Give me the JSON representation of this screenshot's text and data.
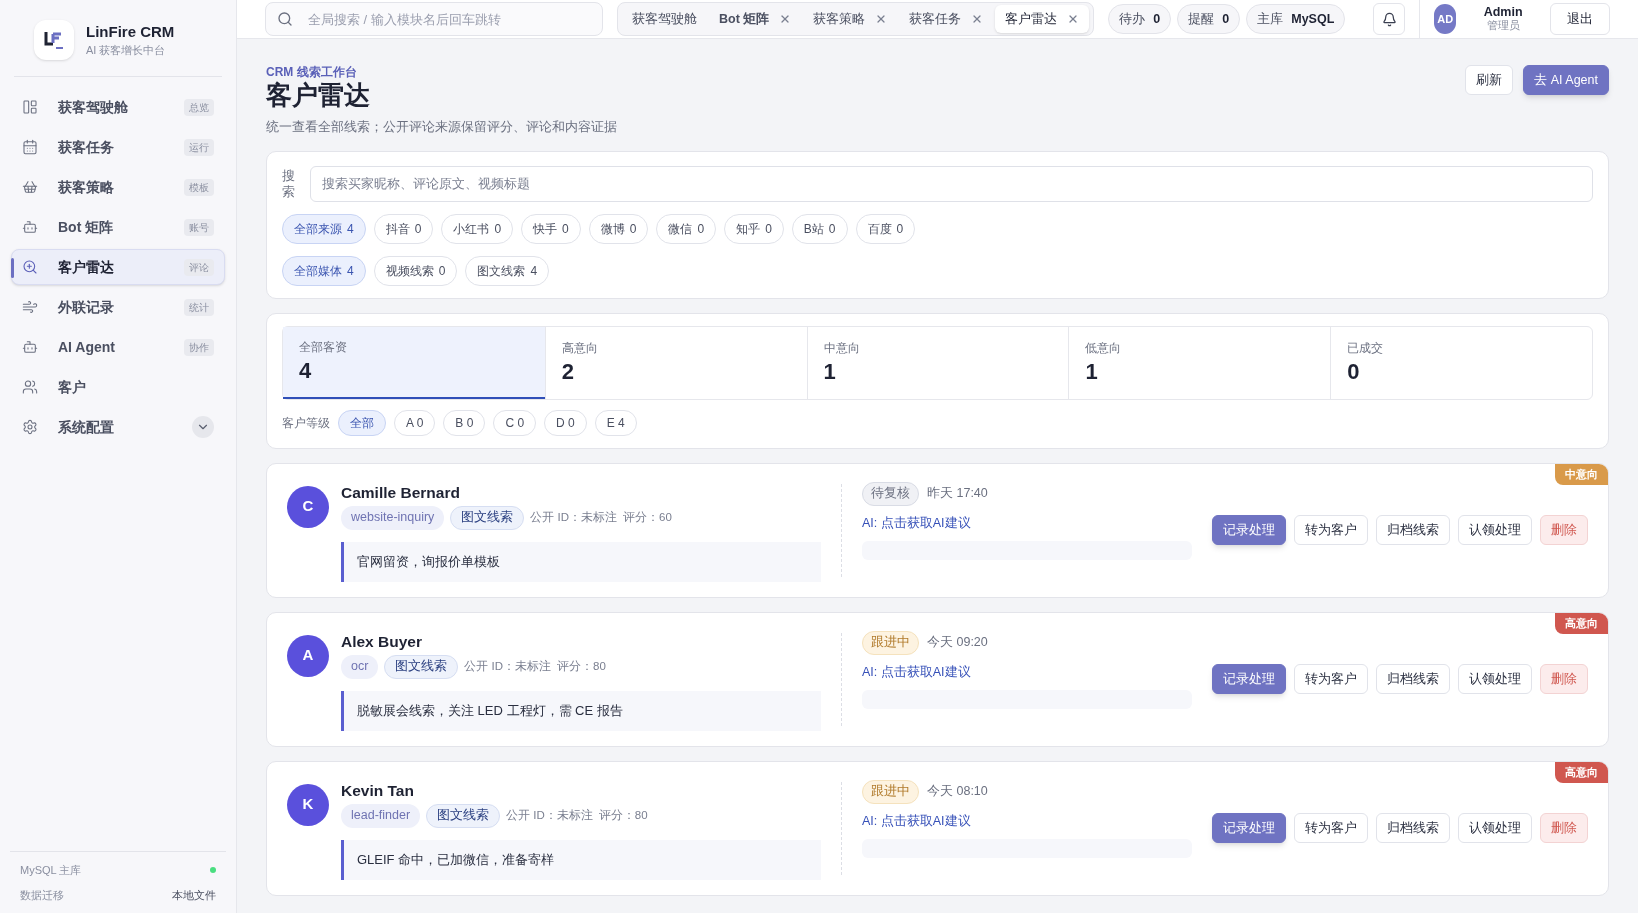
{
  "brand": {
    "name": "LinFire CRM",
    "subtitle": "AI 获客增长中台"
  },
  "sidebar": {
    "items": [
      {
        "label": "获客驾驶舱",
        "badge": "总览",
        "kind": "link",
        "selected": false
      },
      {
        "label": "获客任务",
        "badge": "运行",
        "kind": "link",
        "selected": false
      },
      {
        "label": "获客策略",
        "badge": "模板",
        "kind": "link",
        "selected": false
      },
      {
        "label": "Bot 矩阵",
        "badge": "账号",
        "kind": "link",
        "selected": false
      },
      {
        "label": "客户雷达",
        "badge": "评论",
        "kind": "link",
        "selected": true
      },
      {
        "label": "外联记录",
        "badge": "统计",
        "kind": "link",
        "selected": false
      },
      {
        "label": "AI Agent",
        "badge": "协作",
        "kind": "link",
        "selected": false
      },
      {
        "label": "客户",
        "kind": "link",
        "selected": false
      },
      {
        "label": "系统配置",
        "kind": "group",
        "selected": false
      }
    ],
    "footer": {
      "db": {
        "label": "MySQL 主库",
        "color": "#4ade80"
      },
      "migration_label": "数据迁移",
      "migration_value": "本地文件"
    }
  },
  "topbar": {
    "search": {
      "placeholder": "全局搜索 / 输入模块名后回车跳转"
    },
    "tabs": [
      {
        "label": "获客驾驶舱",
        "closable": false,
        "selected": false
      },
      {
        "label": "Bot 矩阵",
        "closable": true,
        "selected": false
      },
      {
        "label": "获客策略",
        "closable": true,
        "selected": false
      },
      {
        "label": "获客任务",
        "closable": true,
        "selected": false
      },
      {
        "label": "客户雷达",
        "closable": true,
        "selected": true
      }
    ],
    "pills": [
      {
        "label": "待办",
        "value": "0"
      },
      {
        "label": "提醒",
        "value": "0"
      },
      {
        "label": "主库",
        "value": "MySQL"
      }
    ],
    "user": {
      "initials": "AD",
      "name": "Admin",
      "role": "管理员"
    },
    "logout": "退出"
  },
  "page": {
    "eyebrow": "CRM 线索工作台",
    "title": "客户雷达",
    "description": "统一查看全部线索；公开评论来源保留评分、评论和内容证据",
    "buttons": [
      {
        "label": "刷新",
        "kind": "secondary"
      },
      {
        "label": "去 AI Agent",
        "kind": "primary"
      }
    ]
  },
  "filters": {
    "search_label": "搜索",
    "search_placeholder": "搜索买家昵称、评论原文、视频标题",
    "sources": [
      {
        "label": "全部来源",
        "count": "4",
        "selected": true
      },
      {
        "label": "抖音",
        "count": "0",
        "selected": false
      },
      {
        "label": "小红书",
        "count": "0",
        "selected": false
      },
      {
        "label": "快手",
        "count": "0",
        "selected": false
      },
      {
        "label": "微博",
        "count": "0",
        "selected": false
      },
      {
        "label": "微信",
        "count": "0",
        "selected": false
      },
      {
        "label": "知乎",
        "count": "0",
        "selected": false
      },
      {
        "label": "B站",
        "count": "0",
        "selected": false
      },
      {
        "label": "百度",
        "count": "0",
        "selected": false
      }
    ],
    "media": [
      {
        "label": "全部媒体",
        "count": "4",
        "selected": true
      },
      {
        "label": "视频线索",
        "count": "0",
        "selected": false
      },
      {
        "label": "图文线索",
        "count": "4",
        "selected": false
      }
    ]
  },
  "stats": {
    "tabs": [
      {
        "label": "全部客资",
        "value": "4",
        "selected": true
      },
      {
        "label": "高意向",
        "value": "2",
        "selected": false
      },
      {
        "label": "中意向",
        "value": "1",
        "selected": false
      },
      {
        "label": "低意向",
        "value": "1",
        "selected": false
      },
      {
        "label": "已成交",
        "value": "0",
        "selected": false
      }
    ],
    "grade_label": "客户等级",
    "grades": [
      {
        "label": "全部",
        "selected": true
      },
      {
        "label": "A 0",
        "selected": false
      },
      {
        "label": "B 0",
        "selected": false
      },
      {
        "label": "C 0",
        "selected": false
      },
      {
        "label": "D 0",
        "selected": false
      },
      {
        "label": "E 4",
        "selected": false
      }
    ]
  },
  "leads": [
    {
      "initial": "C",
      "name": "Camille Bernard",
      "source": "website-inquiry",
      "media": "图文线索",
      "public_id": "公开 ID：未标注",
      "score": "评分：60",
      "comment": "官网留资，询报价单模板",
      "status": {
        "label": "待复核",
        "kind": "review"
      },
      "time": "昨天 17:40",
      "ai_link": "AI: 点击获取AI建议",
      "intent": {
        "label": "中意向",
        "color": "#d99a4a"
      },
      "actions": [
        {
          "label": "记录处理",
          "kind": "primary"
        },
        {
          "label": "转为客户",
          "kind": "secondary"
        },
        {
          "label": "归档线索",
          "kind": "secondary"
        },
        {
          "label": "认领处理",
          "kind": "secondary"
        },
        {
          "label": "删除",
          "kind": "danger"
        }
      ]
    },
    {
      "initial": "A",
      "name": "Alex Buyer",
      "source": "ocr",
      "media": "图文线索",
      "public_id": "公开 ID：未标注",
      "score": "评分：80",
      "comment": "脱敏展会线索，关注 LED 工程灯，需 CE 报告",
      "status": {
        "label": "跟进中",
        "kind": "following"
      },
      "time": "今天 09:20",
      "ai_link": "AI: 点击获取AI建议",
      "intent": {
        "label": "高意向",
        "color": "#d0574f"
      },
      "actions": [
        {
          "label": "记录处理",
          "kind": "primary"
        },
        {
          "label": "转为客户",
          "kind": "secondary"
        },
        {
          "label": "归档线索",
          "kind": "secondary"
        },
        {
          "label": "认领处理",
          "kind": "secondary"
        },
        {
          "label": "删除",
          "kind": "danger"
        }
      ]
    },
    {
      "initial": "K",
      "name": "Kevin Tan",
      "source": "lead-finder",
      "media": "图文线索",
      "public_id": "公开 ID：未标注",
      "score": "评分：80",
      "comment": "GLEIF 命中，已加微信，准备寄样",
      "status": {
        "label": "跟进中",
        "kind": "following"
      },
      "time": "今天 08:10",
      "ai_link": "AI: 点击获取AI建议",
      "intent": {
        "label": "高意向",
        "color": "#d0574f"
      },
      "actions": [
        {
          "label": "记录处理",
          "kind": "primary"
        },
        {
          "label": "转为客户",
          "kind": "secondary"
        },
        {
          "label": "归档线索",
          "kind": "secondary"
        },
        {
          "label": "认领处理",
          "kind": "secondary"
        },
        {
          "label": "删除",
          "kind": "danger"
        }
      ]
    }
  ]
}
